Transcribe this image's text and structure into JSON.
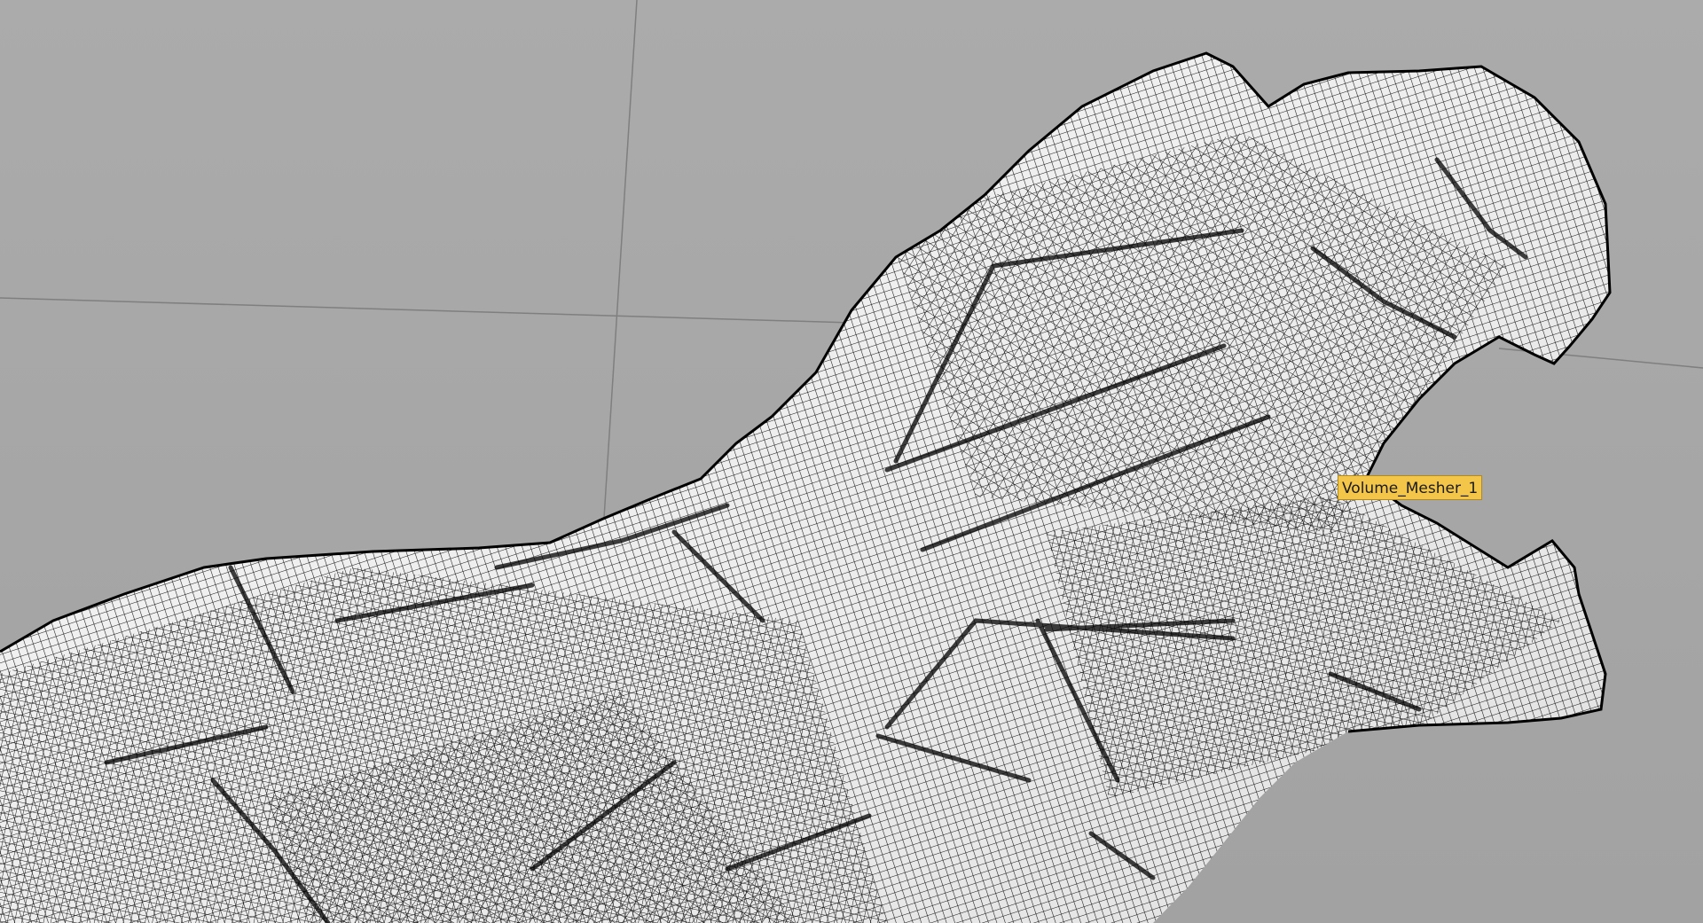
{
  "viewport": {
    "background_color": "#a8a8a8",
    "grid_line_color": "#7f7f7f",
    "mesh_fill_color": "#f2f2f2",
    "mesh_wire_color": "#111111",
    "object_label": {
      "text": "Volume_Mesher_1",
      "background_color": "#f3c64a"
    }
  }
}
